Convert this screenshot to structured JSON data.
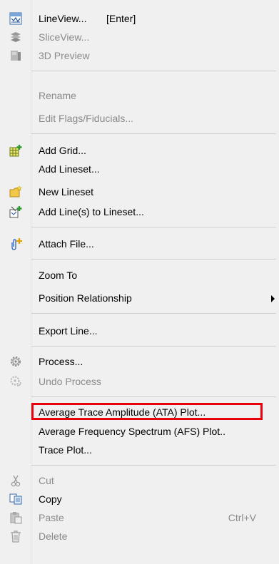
{
  "menu": {
    "items": {
      "lineview": {
        "label": "LineView...",
        "shortcut": "[Enter]"
      },
      "sliceview": {
        "label": "SliceView..."
      },
      "preview3d": {
        "label": "3D Preview"
      },
      "rename": {
        "label": "Rename"
      },
      "edit_flags": {
        "label": "Edit Flags/Fiducials..."
      },
      "add_grid": {
        "label": "Add Grid..."
      },
      "add_lineset": {
        "label": "Add Lineset..."
      },
      "new_lineset": {
        "label": "New Lineset"
      },
      "add_lines_to_lineset": {
        "label": "Add Line(s) to Lineset..."
      },
      "attach_file": {
        "label": "Attach File..."
      },
      "zoom_to": {
        "label": "Zoom To"
      },
      "position_relationship": {
        "label": "Position Relationship"
      },
      "export_line": {
        "label": "Export Line..."
      },
      "process": {
        "label": "Process..."
      },
      "undo_process": {
        "label": "Undo Process"
      },
      "ata_plot": {
        "label": "Average Trace Amplitude (ATA) Plot..."
      },
      "afs_plot": {
        "label": "Average Frequency Spectrum (AFS) Plot.."
      },
      "trace_plot": {
        "label": "Trace Plot..."
      },
      "cut": {
        "label": "Cut"
      },
      "copy": {
        "label": "Copy"
      },
      "paste": {
        "label": "Paste",
        "shortcut": "Ctrl+V"
      },
      "delete": {
        "label": "Delete"
      }
    },
    "colors": {
      "highlight_border": "#e8000a",
      "disabled_text": "#8a8a8a",
      "background": "#f0f0f0"
    }
  }
}
